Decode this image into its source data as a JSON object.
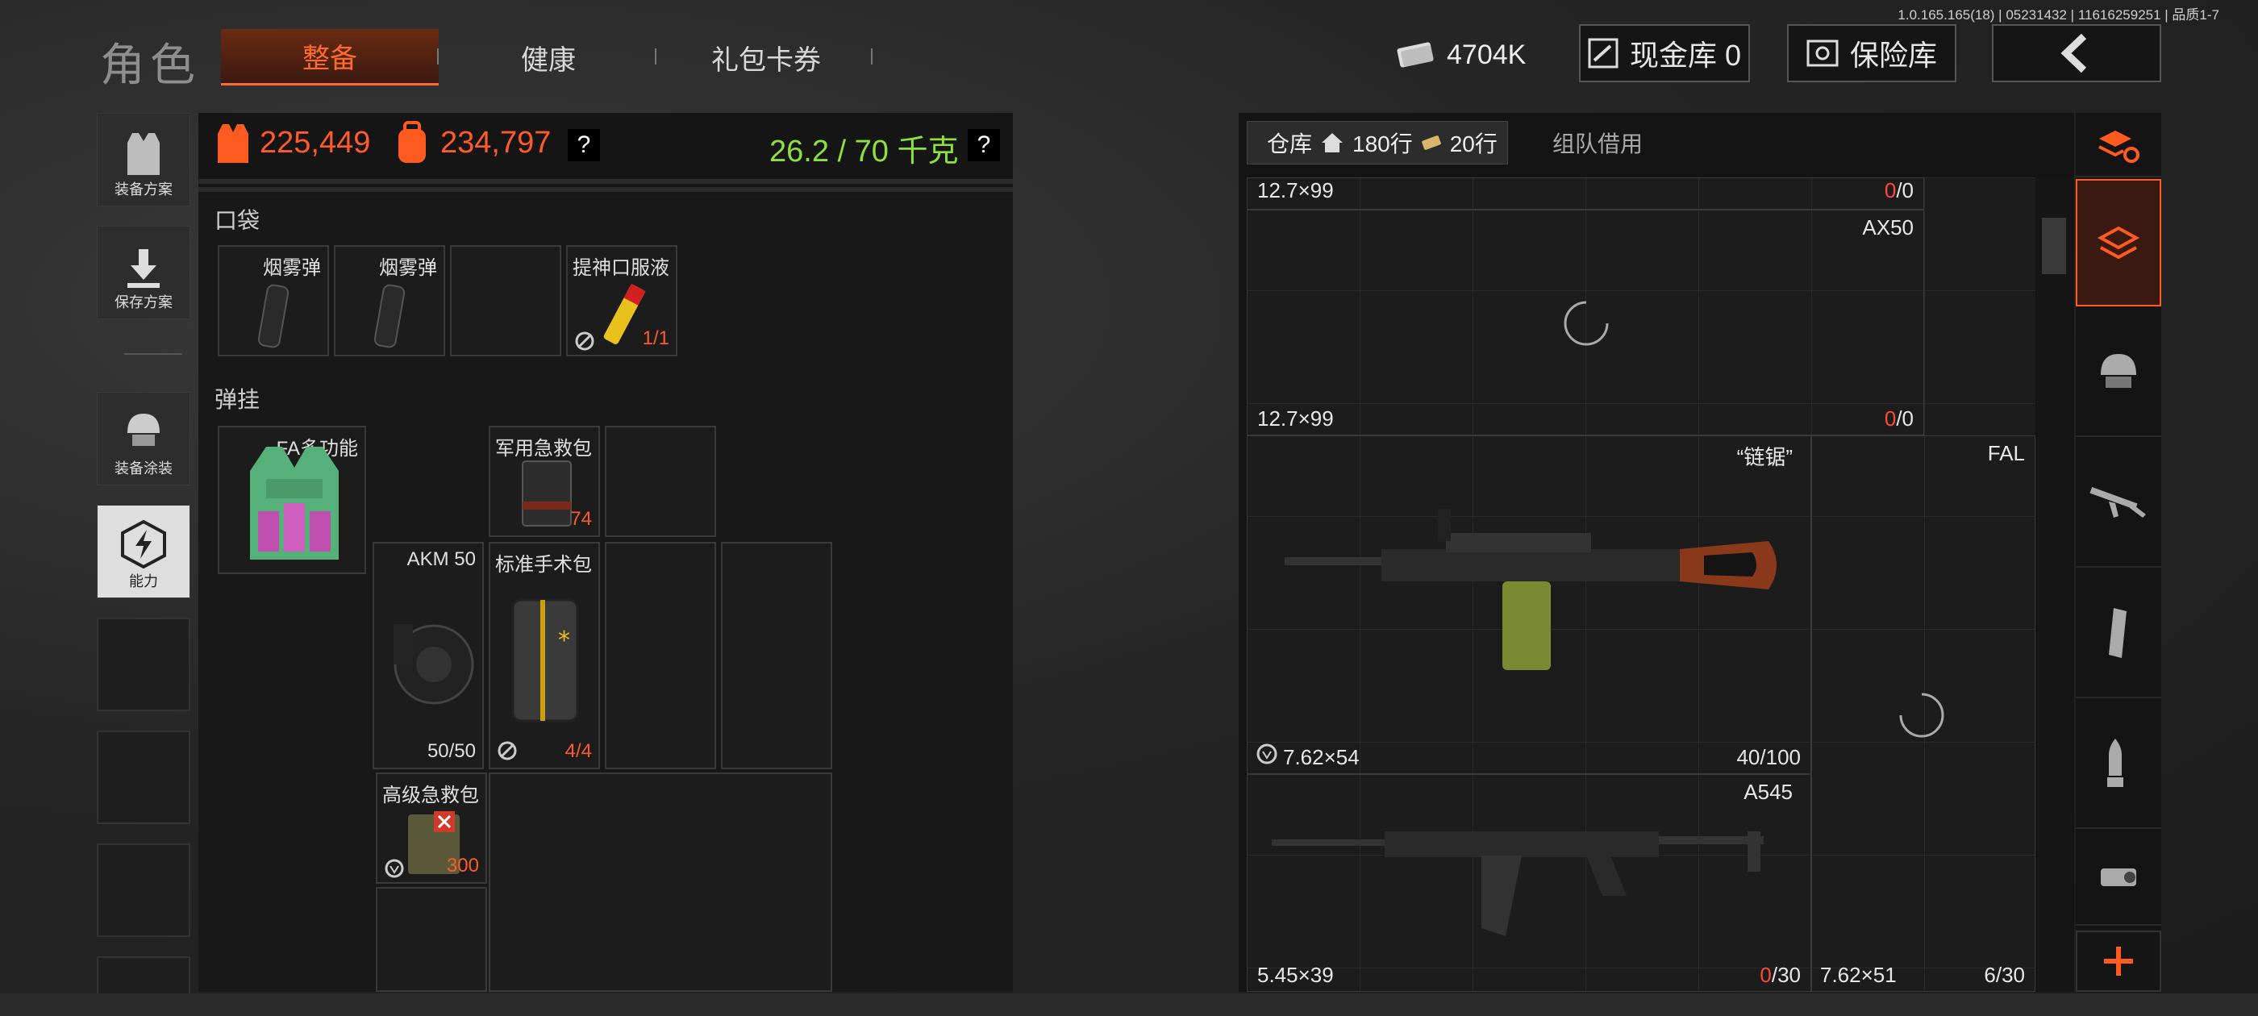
{
  "version": "1.0.165.165(18) | 05231432 | 11616259251 | 品质1-7",
  "title": "角色",
  "tabs": [
    {
      "label": "整备",
      "active": true
    },
    {
      "label": "健康",
      "active": false
    },
    {
      "label": "礼包卡券",
      "active": false
    }
  ],
  "header": {
    "currency": "4704K",
    "cash_vault": "现金库 0",
    "safe": "保险库"
  },
  "sidebar": {
    "items": [
      {
        "label": "装备方案"
      },
      {
        "label": "保存方案"
      },
      {
        "label": "装备涂装"
      },
      {
        "label": "能力"
      }
    ]
  },
  "stats": {
    "value1": "225,449",
    "value2": "234,797",
    "help1": "?",
    "weight": "26.2 / 70 千克",
    "help2": "?"
  },
  "pockets": {
    "label": "口袋",
    "items": [
      {
        "name": "烟雾弹",
        "count": ""
      },
      {
        "name": "烟雾弹",
        "count": ""
      },
      {
        "name": "",
        "count": ""
      },
      {
        "name": "提神口服液",
        "count": "1/1"
      }
    ]
  },
  "rig": {
    "label": "弹挂",
    "vest_name": "FA多功能",
    "items": [
      {
        "name": "军用急救包",
        "count": "74"
      },
      {
        "name": "AKM 50",
        "count": "50/50"
      },
      {
        "name": "标准手术包",
        "count": "4/4"
      },
      {
        "name": "高级急救包",
        "count": "300"
      }
    ]
  },
  "warehouse": {
    "tab_label": "仓库",
    "rows": "180行",
    "rows2": "20行",
    "team_tab": "组队借用",
    "items": [
      {
        "caliber": "12.7×99",
        "count_red": "0",
        "count_rest": "/0"
      },
      {
        "name": "AX50",
        "caliber": "12.7×99",
        "count_red": "0",
        "count_rest": "/0"
      },
      {
        "name": "“链锯”",
        "caliber": "7.62×54",
        "count": "40/100"
      },
      {
        "name": "FAL",
        "caliber": "7.62×51",
        "count": "6/30"
      },
      {
        "name": "A545",
        "caliber": "5.45×39",
        "count_red": "0",
        "count_rest": "/30"
      }
    ]
  },
  "colors": {
    "accent": "#ff6a2c",
    "weight": "#8ee03a",
    "red": "#ff4a3a"
  }
}
